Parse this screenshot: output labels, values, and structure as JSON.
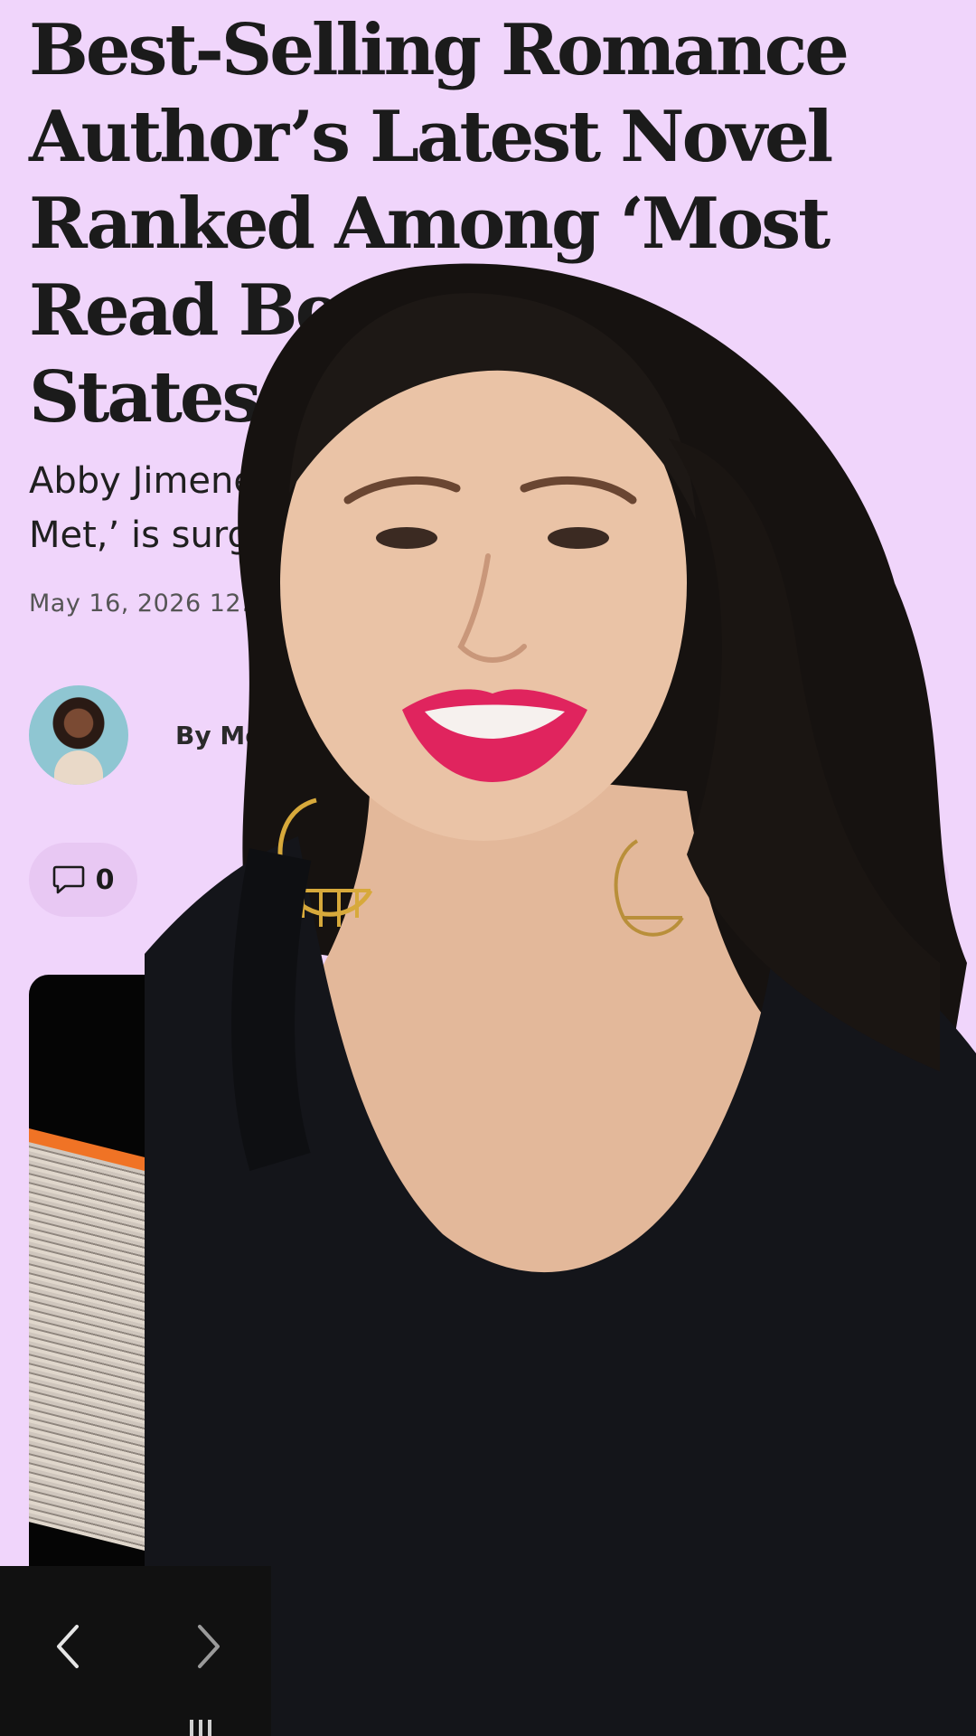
{
  "article": {
    "headline_lines": [
      "Best-Selling Romance",
      "Author’s Latest Novel",
      "Ranked Among ‘Most",
      "Read Books’ in",
      "States on G"
    ],
    "subhead_lines": [
      "Abby Jimenez’s",
      "Met,’ is surging"
    ],
    "dateline": "May 16, 2026 12:52",
    "byline": "By Melina",
    "comment_count": "0"
  },
  "colors": {
    "page_background": "#f0d5fb",
    "pill_background": "#e8c8f3",
    "lipstick": "#e0245e"
  },
  "icons": {
    "comment": "comment-icon",
    "google": "google-icon",
    "back": "chevron-left-icon",
    "forward": "chevron-right-icon"
  }
}
